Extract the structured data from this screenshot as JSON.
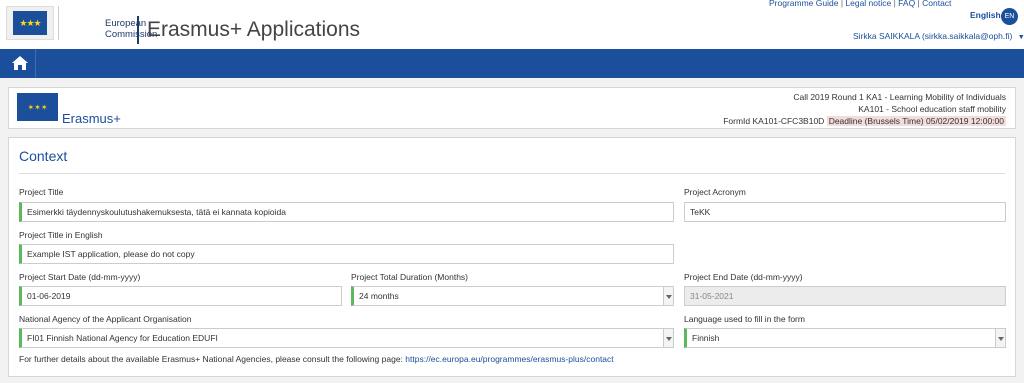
{
  "header": {
    "ec_name_line1": "European",
    "ec_name_line2": "Commission",
    "app_title": "Erasmus+ Applications",
    "links": [
      "Programme Guide",
      "Legal notice",
      "FAQ",
      "Contact"
    ],
    "language": "English",
    "language_code": "EN",
    "user": "Sirkka SAIKKALA (sirkka.saikkala@oph.fi)"
  },
  "info": {
    "brand": "Erasmus+",
    "call": "Call 2019",
    "round": "Round 1",
    "action": "KA1 - Learning Mobility of Individuals",
    "subaction": "KA101 - School education staff mobility",
    "form_id": "FormId KA101-CFC3B10D",
    "deadline": "Deadline (Brussels Time) 05/02/2019 12:00:00"
  },
  "context": {
    "title": "Context",
    "project_title_label": "Project Title",
    "project_title_value": "Esimerkki täydennyskoulutushakemuksesta, tätä ei kannata kopioida",
    "project_acronym_label": "Project Acronym",
    "project_acronym_value": "TeKK",
    "project_title_en_label": "Project Title in English",
    "project_title_en_value": "Example IST application, please do not copy",
    "start_date_label": "Project Start Date (dd-mm-yyyy)",
    "start_date_value": "01-06-2019",
    "duration_label": "Project Total Duration (Months)",
    "duration_value": "24 months",
    "end_date_label": "Project End Date (dd-mm-yyyy)",
    "end_date_value": "31-05-2021",
    "national_agency_label": "National Agency of the Applicant Organisation",
    "national_agency_value": "FI01 Finnish National Agency for Education EDUFI",
    "form_language_label": "Language used to fill in the form",
    "form_language_value": "Finnish",
    "note_text": "For further details about the available Erasmus+ National Agencies, please consult the following page:",
    "note_link": "https://ec.europa.eu/programmes/erasmus-plus/contact"
  }
}
